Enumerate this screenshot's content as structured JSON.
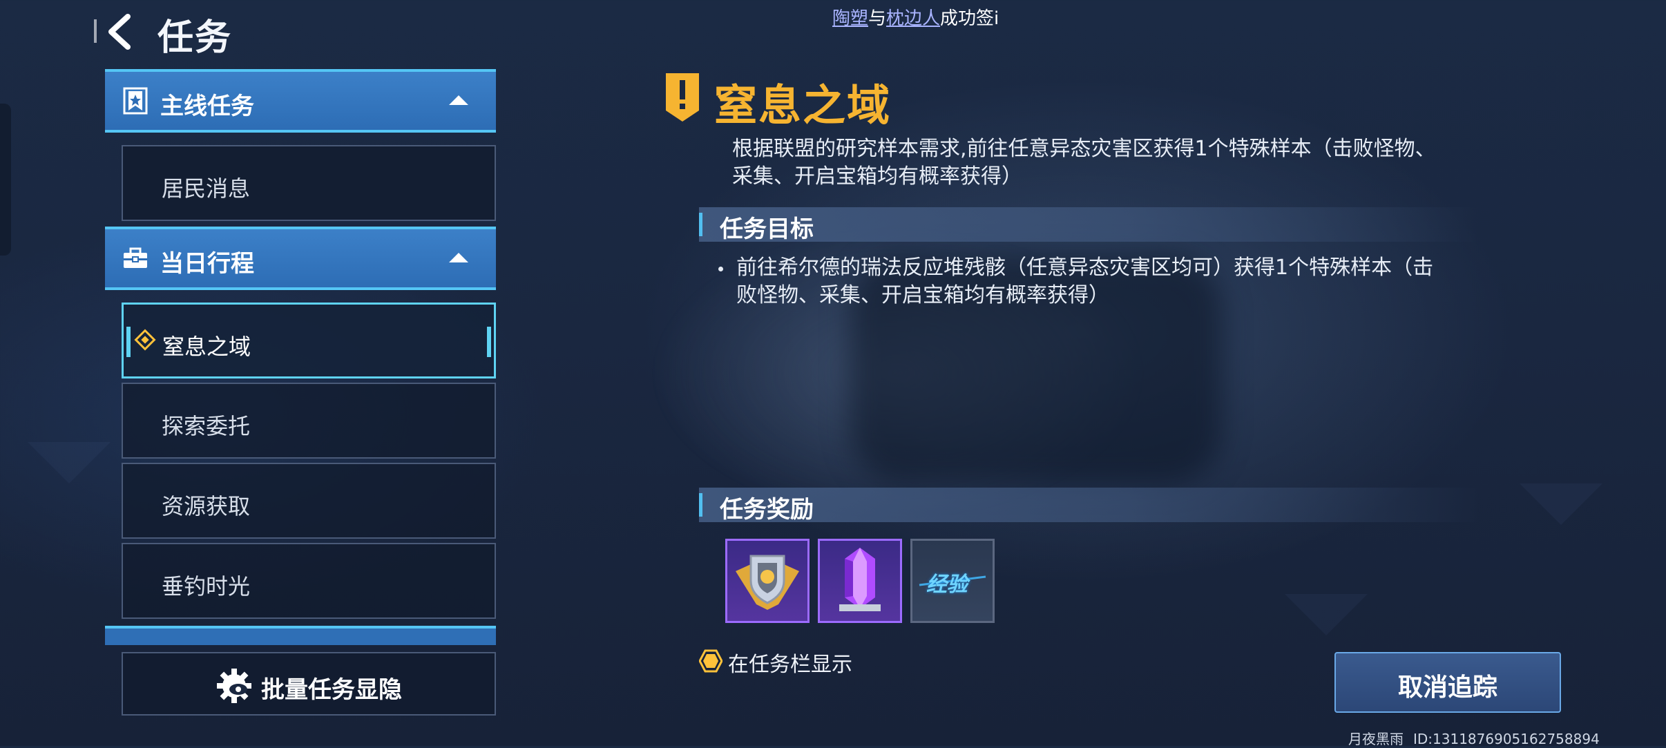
{
  "header": {
    "title": "任务",
    "marquee": {
      "name1": "陶塑",
      "connector": "与",
      "name2": "枕边人",
      "suffix": "成功签i"
    }
  },
  "sidebar": {
    "categories": [
      {
        "label": "主线任务"
      },
      {
        "label": "当日行程"
      }
    ],
    "items": [
      {
        "label": "居民消息"
      },
      {
        "label": "窒息之域",
        "selected": true
      },
      {
        "label": "探索委托"
      },
      {
        "label": "资源获取"
      },
      {
        "label": "垂钓时光"
      }
    ],
    "bulk_button": "批量任务显隐"
  },
  "quest": {
    "title": "窒息之域",
    "description": "根据联盟的研究样本需求,前往任意异态灾害区获得1个特殊样本（击败怪物、采集、开启宝箱均有概率获得）",
    "objective_heading": "任务目标",
    "objective": "前往希尔德的瑞法反应堆残骸（任意异态灾害区均可）获得1个特殊样本（击败怪物、采集、开启宝箱均有概率获得）",
    "reward_heading": "任务奖励",
    "rewards": [
      {
        "icon": "gold-shield-badge-icon"
      },
      {
        "icon": "purple-crystal-icon"
      },
      {
        "icon": "exp-icon",
        "label": "经验"
      }
    ],
    "show_in_taskbar": "在任务栏显示",
    "untrack_button": "取消追踪"
  },
  "footer": {
    "user": "月夜黑雨",
    "id": "ID:13118769051627588​94"
  },
  "colors": {
    "accent_blue": "#3c80c8",
    "accent_cyan": "#55c6f5",
    "title_gold": "#f6b431",
    "reward_purple": "#9c6bff"
  }
}
